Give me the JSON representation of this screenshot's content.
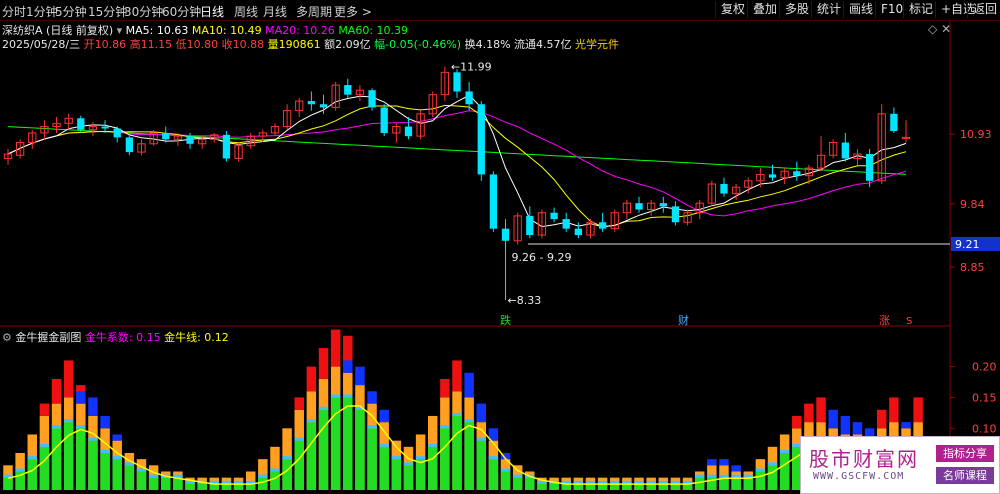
{
  "toolbar": {
    "timeframes": [
      "分时",
      "1分钟",
      "5分钟",
      "15分钟",
      "30分钟",
      "60分钟",
      "日线",
      "周线",
      "月线",
      "多周期",
      "更多 >"
    ],
    "active_index": 6,
    "right_buttons": [
      "复权",
      "叠加",
      "多股",
      "统计",
      "画线",
      "F10",
      "标记",
      "+自选",
      "返回"
    ]
  },
  "header": {
    "stock_name": "深纺织A",
    "adjust": "(日线 前复权)",
    "ma5": "MA5: 10.63",
    "ma10": "MA10: 10.49",
    "ma20": "MA20: 10.26",
    "ma60": "MA60: 10.39"
  },
  "ohlc": {
    "date": "2025/05/28/三",
    "open": "开10.86",
    "high": "高11.15",
    "low": "低10.80",
    "close": "收10.88",
    "volume": "量190861",
    "amount": "额2.09亿",
    "change": "幅-0.05(-0.46%)",
    "turnover": "换4.18%",
    "float": "流通4.57亿",
    "concept": "光学元件"
  },
  "price_axis": [
    "10.93",
    "9.84",
    "8.85"
  ],
  "price_marker": "9.21",
  "annotations": {
    "high_label": "11.99",
    "low_label": "8.33",
    "range_label": "9.26 - 9.29",
    "tag_die": "跌",
    "tag_cai": "财",
    "tag_zhang": "涨",
    "tag_s": "S"
  },
  "sub": {
    "title": "金牛握金副图",
    "coef": "金牛系数: 0.15",
    "line": "金牛线: 0.12",
    "axis": [
      "0.20",
      "0.15",
      "0.10"
    ]
  },
  "watermark": {
    "title": "股市财富网",
    "url": "WWW.GSCFW.COM",
    "btn1": "指标分享",
    "btn2": "名师课程"
  },
  "colors": {
    "up": "#ff3232",
    "down": "#00e5ff",
    "ma5": "#ffffff",
    "ma10": "#ffff00",
    "ma20": "#ff00ff",
    "ma60": "#00ff00",
    "bar_green": "#22dd22",
    "bar_orange": "#ffa020",
    "bar_red": "#ee1111",
    "bar_blue": "#1133ff"
  },
  "chart_data": {
    "type": "candlestick",
    "candles": [
      [
        10.55,
        10.7,
        10.45,
        10.62
      ],
      [
        10.6,
        10.85,
        10.55,
        10.8
      ],
      [
        10.8,
        11.0,
        10.7,
        10.95
      ],
      [
        10.95,
        11.15,
        10.85,
        11.05
      ],
      [
        11.05,
        11.2,
        10.95,
        11.1
      ],
      [
        11.1,
        11.25,
        11.0,
        11.18
      ],
      [
        11.18,
        11.22,
        10.95,
        11.0
      ],
      [
        11.0,
        11.12,
        10.9,
        11.05
      ],
      [
        11.05,
        11.15,
        10.95,
        11.02
      ],
      [
        11.02,
        11.05,
        10.8,
        10.88
      ],
      [
        10.88,
        10.92,
        10.6,
        10.65
      ],
      [
        10.65,
        10.85,
        10.6,
        10.78
      ],
      [
        10.78,
        11.0,
        10.75,
        10.95
      ],
      [
        10.95,
        11.05,
        10.8,
        10.85
      ],
      [
        10.85,
        10.95,
        10.75,
        10.9
      ],
      [
        10.9,
        10.95,
        10.7,
        10.78
      ],
      [
        10.78,
        10.9,
        10.7,
        10.85
      ],
      [
        10.85,
        10.95,
        10.8,
        10.92
      ],
      [
        10.92,
        10.98,
        10.5,
        10.55
      ],
      [
        10.55,
        10.8,
        10.5,
        10.75
      ],
      [
        10.75,
        10.95,
        10.7,
        10.9
      ],
      [
        10.9,
        11.0,
        10.8,
        10.95
      ],
      [
        10.95,
        11.1,
        10.9,
        11.05
      ],
      [
        11.05,
        11.4,
        11.0,
        11.3
      ],
      [
        11.3,
        11.5,
        11.2,
        11.45
      ],
      [
        11.45,
        11.6,
        11.3,
        11.4
      ],
      [
        11.4,
        11.55,
        11.25,
        11.35
      ],
      [
        11.35,
        11.75,
        11.3,
        11.7
      ],
      [
        11.7,
        11.8,
        11.5,
        11.55
      ],
      [
        11.55,
        11.7,
        11.45,
        11.62
      ],
      [
        11.62,
        11.65,
        11.3,
        11.35
      ],
      [
        11.35,
        11.4,
        10.9,
        10.95
      ],
      [
        10.95,
        11.1,
        10.8,
        11.05
      ],
      [
        11.05,
        11.2,
        10.85,
        10.9
      ],
      [
        10.9,
        11.3,
        10.85,
        11.25
      ],
      [
        11.25,
        11.6,
        11.2,
        11.55
      ],
      [
        11.55,
        11.99,
        11.45,
        11.9
      ],
      [
        11.9,
        11.95,
        11.5,
        11.6
      ],
      [
        11.6,
        11.75,
        11.3,
        11.4
      ],
      [
        11.4,
        11.45,
        10.2,
        10.3
      ],
      [
        10.3,
        10.35,
        9.4,
        9.45
      ],
      [
        9.45,
        9.6,
        8.33,
        9.26
      ],
      [
        9.26,
        9.7,
        9.2,
        9.65
      ],
      [
        9.65,
        9.8,
        9.3,
        9.35
      ],
      [
        9.35,
        9.75,
        9.3,
        9.7
      ],
      [
        9.7,
        9.78,
        9.55,
        9.6
      ],
      [
        9.6,
        9.7,
        9.4,
        9.45
      ],
      [
        9.45,
        9.55,
        9.3,
        9.35
      ],
      [
        9.35,
        9.6,
        9.3,
        9.55
      ],
      [
        9.55,
        9.7,
        9.4,
        9.45
      ],
      [
        9.45,
        9.75,
        9.4,
        9.7
      ],
      [
        9.7,
        9.9,
        9.6,
        9.85
      ],
      [
        9.85,
        9.95,
        9.7,
        9.75
      ],
      [
        9.75,
        9.9,
        9.65,
        9.85
      ],
      [
        9.85,
        9.95,
        9.7,
        9.8
      ],
      [
        9.8,
        9.88,
        9.5,
        9.55
      ],
      [
        9.55,
        9.75,
        9.5,
        9.7
      ],
      [
        9.7,
        9.9,
        9.6,
        9.85
      ],
      [
        9.85,
        10.2,
        9.8,
        10.15
      ],
      [
        10.15,
        10.25,
        9.95,
        10.0
      ],
      [
        10.0,
        10.15,
        9.9,
        10.1
      ],
      [
        10.1,
        10.25,
        10.0,
        10.2
      ],
      [
        10.2,
        10.4,
        10.1,
        10.3
      ],
      [
        10.3,
        10.45,
        10.2,
        10.25
      ],
      [
        10.25,
        10.4,
        10.15,
        10.35
      ],
      [
        10.35,
        10.5,
        10.2,
        10.28
      ],
      [
        10.28,
        10.45,
        10.15,
        10.4
      ],
      [
        10.4,
        10.9,
        10.35,
        10.6
      ],
      [
        10.6,
        10.85,
        10.55,
        10.8
      ],
      [
        10.8,
        10.95,
        10.5,
        10.55
      ],
      [
        10.55,
        10.7,
        10.45,
        10.62
      ],
      [
        10.62,
        10.7,
        10.1,
        10.2
      ],
      [
        10.2,
        11.4,
        10.15,
        11.25
      ],
      [
        11.25,
        11.35,
        10.95,
        10.98
      ],
      [
        10.86,
        11.15,
        10.8,
        10.88
      ]
    ],
    "sub_bars": [
      {
        "g": 0.02,
        "o": 0.04,
        "r": 0,
        "b": 0
      },
      {
        "g": 0.03,
        "o": 0.06,
        "r": 0,
        "b": 0
      },
      {
        "g": 0.05,
        "o": 0.09,
        "r": 0,
        "b": 0
      },
      {
        "g": 0.07,
        "o": 0.12,
        "r": 0.02,
        "b": 0
      },
      {
        "g": 0.1,
        "o": 0.14,
        "r": 0.04,
        "b": 0
      },
      {
        "g": 0.11,
        "o": 0.15,
        "r": 0.06,
        "b": 0
      },
      {
        "g": 0.1,
        "o": 0.14,
        "r": 0.03,
        "b": 0.02
      },
      {
        "g": 0.08,
        "o": 0.12,
        "r": 0,
        "b": 0.03
      },
      {
        "g": 0.06,
        "o": 0.1,
        "r": 0,
        "b": 0.02
      },
      {
        "g": 0.05,
        "o": 0.08,
        "r": 0,
        "b": 0.01
      },
      {
        "g": 0.04,
        "o": 0.06,
        "r": 0,
        "b": 0
      },
      {
        "g": 0.03,
        "o": 0.05,
        "r": 0,
        "b": 0
      },
      {
        "g": 0.02,
        "o": 0.04,
        "r": 0,
        "b": 0
      },
      {
        "g": 0.02,
        "o": 0.03,
        "r": 0,
        "b": 0
      },
      {
        "g": 0.02,
        "o": 0.03,
        "r": 0,
        "b": 0
      },
      {
        "g": 0.01,
        "o": 0.02,
        "r": 0,
        "b": 0
      },
      {
        "g": 0.01,
        "o": 0.02,
        "r": 0,
        "b": 0
      },
      {
        "g": 0.01,
        "o": 0.02,
        "r": 0,
        "b": 0
      },
      {
        "g": 0.01,
        "o": 0.02,
        "r": 0,
        "b": 0
      },
      {
        "g": 0.01,
        "o": 0.02,
        "r": 0,
        "b": 0
      },
      {
        "g": 0.01,
        "o": 0.03,
        "r": 0,
        "b": 0
      },
      {
        "g": 0.02,
        "o": 0.05,
        "r": 0,
        "b": 0
      },
      {
        "g": 0.03,
        "o": 0.07,
        "r": 0,
        "b": 0
      },
      {
        "g": 0.05,
        "o": 0.1,
        "r": 0,
        "b": 0
      },
      {
        "g": 0.08,
        "o": 0.13,
        "r": 0.02,
        "b": 0
      },
      {
        "g": 0.11,
        "o": 0.16,
        "r": 0.04,
        "b": 0
      },
      {
        "g": 0.13,
        "o": 0.18,
        "r": 0.05,
        "b": 0
      },
      {
        "g": 0.15,
        "o": 0.2,
        "r": 0.06,
        "b": 0
      },
      {
        "g": 0.15,
        "o": 0.19,
        "r": 0.06,
        "b": 0.02
      },
      {
        "g": 0.13,
        "o": 0.17,
        "r": 0,
        "b": 0.03
      },
      {
        "g": 0.1,
        "o": 0.14,
        "r": 0,
        "b": 0.02
      },
      {
        "g": 0.07,
        "o": 0.11,
        "r": 0,
        "b": 0.02
      },
      {
        "g": 0.05,
        "o": 0.08,
        "r": 0,
        "b": 0
      },
      {
        "g": 0.04,
        "o": 0.07,
        "r": 0,
        "b": 0
      },
      {
        "g": 0.05,
        "o": 0.09,
        "r": 0,
        "b": 0
      },
      {
        "g": 0.07,
        "o": 0.12,
        "r": 0,
        "b": 0
      },
      {
        "g": 0.1,
        "o": 0.15,
        "r": 0.03,
        "b": 0
      },
      {
        "g": 0.12,
        "o": 0.16,
        "r": 0.05,
        "b": 0
      },
      {
        "g": 0.11,
        "o": 0.15,
        "r": 0,
        "b": 0.04
      },
      {
        "g": 0.08,
        "o": 0.11,
        "r": 0,
        "b": 0.03
      },
      {
        "g": 0.05,
        "o": 0.08,
        "r": 0,
        "b": 0.02
      },
      {
        "g": 0.03,
        "o": 0.05,
        "r": 0,
        "b": 0.01
      },
      {
        "g": 0.02,
        "o": 0.04,
        "r": 0,
        "b": 0
      },
      {
        "g": 0.02,
        "o": 0.03,
        "r": 0,
        "b": 0
      },
      {
        "g": 0.01,
        "o": 0.02,
        "r": 0,
        "b": 0
      },
      {
        "g": 0.01,
        "o": 0.02,
        "r": 0,
        "b": 0
      },
      {
        "g": 0.01,
        "o": 0.02,
        "r": 0,
        "b": 0
      },
      {
        "g": 0.01,
        "o": 0.02,
        "r": 0,
        "b": 0
      },
      {
        "g": 0.01,
        "o": 0.02,
        "r": 0,
        "b": 0
      },
      {
        "g": 0.01,
        "o": 0.02,
        "r": 0,
        "b": 0
      },
      {
        "g": 0.01,
        "o": 0.02,
        "r": 0,
        "b": 0
      },
      {
        "g": 0.01,
        "o": 0.02,
        "r": 0,
        "b": 0
      },
      {
        "g": 0.01,
        "o": 0.02,
        "r": 0,
        "b": 0
      },
      {
        "g": 0.01,
        "o": 0.02,
        "r": 0,
        "b": 0
      },
      {
        "g": 0.01,
        "o": 0.02,
        "r": 0,
        "b": 0
      },
      {
        "g": 0.01,
        "o": 0.02,
        "r": 0,
        "b": 0
      },
      {
        "g": 0.01,
        "o": 0.02,
        "r": 0,
        "b": 0
      },
      {
        "g": 0.02,
        "o": 0.03,
        "r": 0,
        "b": 0
      },
      {
        "g": 0.02,
        "o": 0.04,
        "r": 0,
        "b": 0.01
      },
      {
        "g": 0.02,
        "o": 0.04,
        "r": 0,
        "b": 0.01
      },
      {
        "g": 0.02,
        "o": 0.03,
        "r": 0,
        "b": 0.01
      },
      {
        "g": 0.02,
        "o": 0.03,
        "r": 0,
        "b": 0
      },
      {
        "g": 0.03,
        "o": 0.05,
        "r": 0,
        "b": 0
      },
      {
        "g": 0.04,
        "o": 0.07,
        "r": 0,
        "b": 0
      },
      {
        "g": 0.06,
        "o": 0.09,
        "r": 0,
        "b": 0
      },
      {
        "g": 0.07,
        "o": 0.1,
        "r": 0.02,
        "b": 0
      },
      {
        "g": 0.08,
        "o": 0.11,
        "r": 0.03,
        "b": 0
      },
      {
        "g": 0.08,
        "o": 0.11,
        "r": 0.04,
        "b": 0
      },
      {
        "g": 0.07,
        "o": 0.1,
        "r": 0,
        "b": 0.03
      },
      {
        "g": 0.07,
        "o": 0.09,
        "r": 0,
        "b": 0.03
      },
      {
        "g": 0.06,
        "o": 0.09,
        "r": 0,
        "b": 0.02
      },
      {
        "g": 0.06,
        "o": 0.08,
        "r": 0,
        "b": 0.02
      },
      {
        "g": 0.06,
        "o": 0.1,
        "r": 0.03,
        "b": 0
      },
      {
        "g": 0.07,
        "o": 0.11,
        "r": 0.04,
        "b": 0
      },
      {
        "g": 0.06,
        "o": 0.1,
        "r": 0,
        "b": 0.01
      },
      {
        "g": 0.07,
        "o": 0.11,
        "r": 0.04,
        "b": 0
      }
    ]
  }
}
